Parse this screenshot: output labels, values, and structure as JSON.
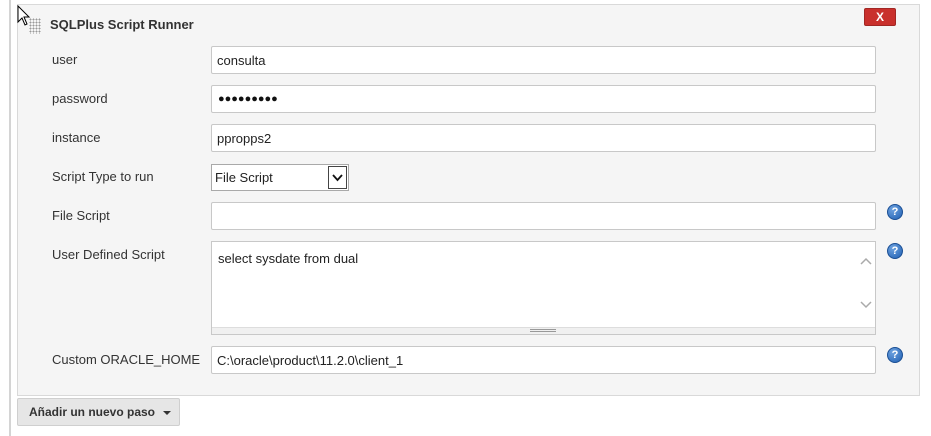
{
  "panel": {
    "title": "SQLPlus Script Runner",
    "close_label": "X"
  },
  "fields": {
    "user": {
      "label": "user",
      "value": "consulta"
    },
    "password": {
      "label": "password",
      "masked": "●●●●●●●●●"
    },
    "instance": {
      "label": "instance",
      "value": "ppropps2"
    },
    "script_type": {
      "label": "Script Type to run",
      "selected": "File Script"
    },
    "file_script": {
      "label": "File Script",
      "value": ""
    },
    "user_defined_script": {
      "label": "User Defined Script",
      "value": "select sysdate from dual"
    },
    "oracle_home": {
      "label": "Custom ORACLE_HOME",
      "value": "C:\\oracle\\product\\11.2.0\\client_1"
    }
  },
  "help_icon_glyph": "?",
  "add_step": {
    "label": "Añadir un nuevo paso"
  },
  "icons": {
    "drag": "drag-handle-icon",
    "help": "help-icon",
    "dropdown": "chevron-down-icon"
  },
  "colors": {
    "close_button": "#c9302c",
    "help_icon": "#1f5fb2",
    "panel_bg": "#f5f5f5"
  }
}
